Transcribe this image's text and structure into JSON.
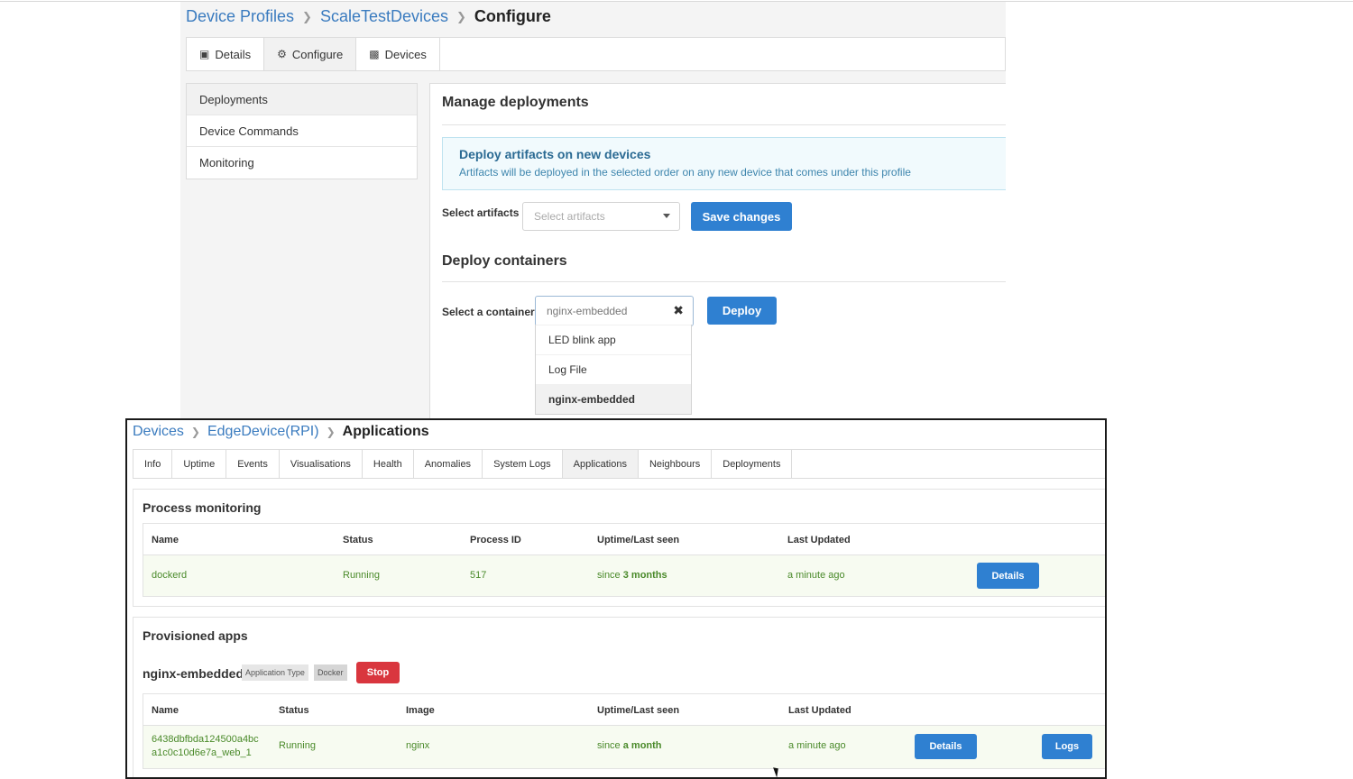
{
  "top": {
    "breadcrumb": [
      "Device Profiles",
      "ScaleTestDevices",
      "Configure"
    ],
    "tabs": [
      {
        "label": "Details",
        "icon": "details-icon"
      },
      {
        "label": "Configure",
        "icon": "gears-icon"
      },
      {
        "label": "Devices",
        "icon": "devices-icon"
      }
    ],
    "sidebar": [
      "Deployments",
      "Device Commands",
      "Monitoring"
    ],
    "manage_title": "Manage deployments",
    "info_title": "Deploy artifacts on new devices",
    "info_text": "Artifacts will be deployed in the selected order on any new device that comes under this profile",
    "artifacts_label": "Select artifacts",
    "artifacts_placeholder": "Select artifacts",
    "save_label": "Save changes",
    "containers_title": "Deploy containers",
    "container_label": "Select a container",
    "container_value": "nginx-embedded",
    "deploy_label": "Deploy",
    "options": [
      "LED blink app",
      "Log File",
      "nginx-embedded"
    ]
  },
  "bottom": {
    "breadcrumb": [
      "Devices",
      "EdgeDevice(RPI)",
      "Applications"
    ],
    "tabs": [
      "Info",
      "Uptime",
      "Events",
      "Visualisations",
      "Health",
      "Anomalies",
      "System Logs",
      "Applications",
      "Neighbours",
      "Deployments"
    ],
    "process": {
      "title": "Process monitoring",
      "headers": [
        "Name",
        "Status",
        "Process ID",
        "Uptime/Last seen",
        "Last Updated"
      ],
      "row": {
        "name": "dockerd",
        "status": "Running",
        "pid": "517",
        "uptime_prefix": "since ",
        "uptime_bold": "3 months",
        "updated": "a minute ago",
        "button": "Details"
      }
    },
    "apps": {
      "title": "Provisioned apps",
      "app_name": "nginx-embedded",
      "badge_type_label": "Application Type",
      "badge_type_value": "Docker",
      "stop_label": "Stop",
      "headers": [
        "Name",
        "Status",
        "Image",
        "Uptime/Last seen",
        "Last Updated"
      ],
      "row": {
        "name_line1": "6438dbfbda124500a4bc",
        "name_line2": "a1c0c10d6e7a_web_1",
        "status": "Running",
        "image": "nginx",
        "uptime_prefix": "since ",
        "uptime_bold": "a month",
        "updated": "a minute ago",
        "details": "Details",
        "logs": "Logs"
      }
    }
  },
  "colors": {
    "link": "#3a7bbf",
    "primary": "#2f80d1",
    "danger": "#d9363e",
    "success_text": "#4a8a2a"
  }
}
